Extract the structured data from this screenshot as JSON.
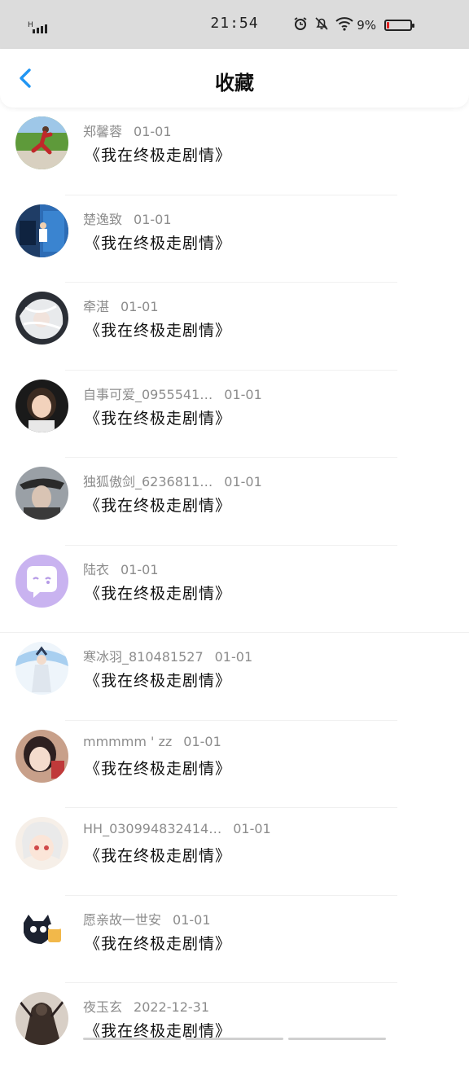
{
  "status_bar": {
    "time": "21:54",
    "battery_percent": "9%",
    "battery_level": 0.09,
    "icons": [
      "signal-icon",
      "alarm-icon",
      "mute-icon",
      "wifi-icon",
      "battery-icon"
    ]
  },
  "header": {
    "title": "收藏",
    "back_icon": "chevron-left-icon",
    "accent_color": "#2196f3"
  },
  "items": [
    {
      "user": "郑馨蓉",
      "date": "01-01",
      "title": "《我在终极走剧情》",
      "avatar": "runner-photo"
    },
    {
      "user": "楚逸致",
      "date": "01-01",
      "title": "《我在终极走剧情》",
      "avatar": "blue-door-photo"
    },
    {
      "user": "牵湛",
      "date": "01-01",
      "title": "《我在终极走剧情》",
      "avatar": "white-hair-anime"
    },
    {
      "user": "自事可爱_0955541…",
      "date": "01-01",
      "title": "《我在终极走剧情》",
      "avatar": "child-photo"
    },
    {
      "user": "独狐傲剑_6236811…",
      "date": "01-01",
      "title": "《我在终极走剧情》",
      "avatar": "hat-man-photo"
    },
    {
      "user": "陆衣",
      "date": "01-01",
      "title": "《我在终极走剧情》",
      "avatar": "chat-bubble-default"
    },
    {
      "user": "寒冰羽_810481527",
      "date": "01-01",
      "title": "《我在终极走剧情》",
      "avatar": "anime-swordsman"
    },
    {
      "user": "mmmmm ' zz",
      "date": "01-01",
      "title": "《我在终极走剧情》",
      "avatar": "girl-photo"
    },
    {
      "user": "HH_030994832414…",
      "date": "01-01",
      "title": "《我在终极走剧情》",
      "avatar": "anime-girl"
    },
    {
      "user": "愿亲故一世安",
      "date": "01-01",
      "title": "《我在终极走剧情》",
      "avatar": "black-cat-cartoon"
    },
    {
      "user": "夜玉玄",
      "date": "2022-12-31",
      "title": "《我在终极走剧情》",
      "avatar": "dark-warrior-art"
    }
  ]
}
